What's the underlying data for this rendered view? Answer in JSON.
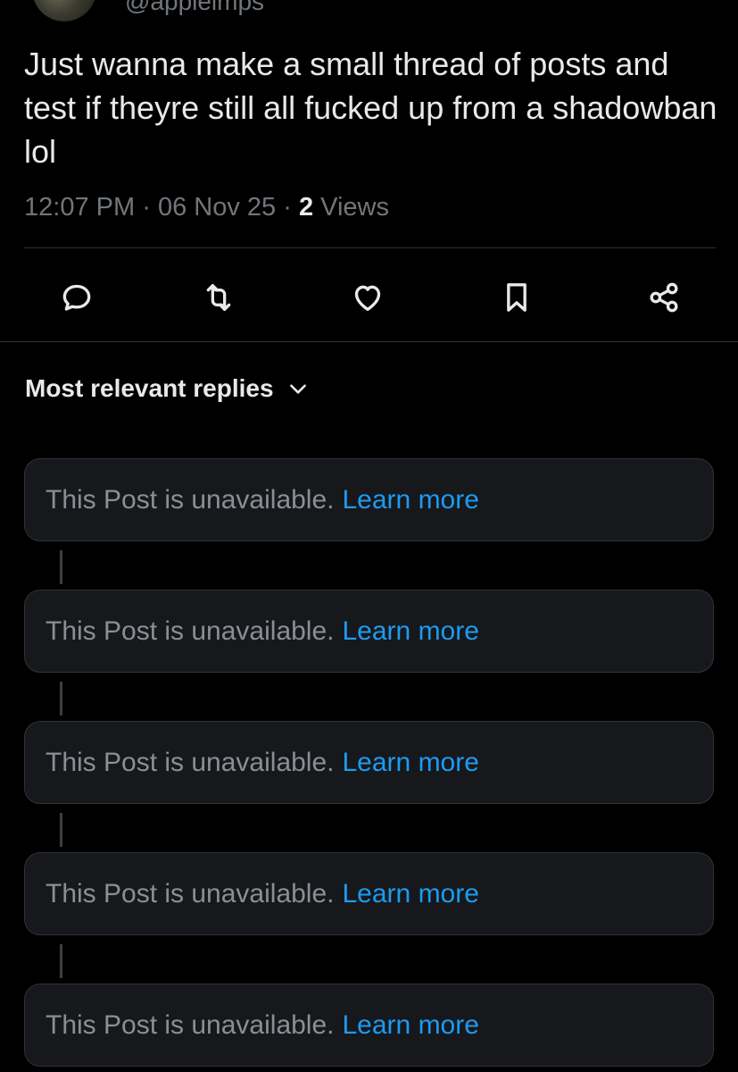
{
  "author": {
    "handle": "@appleimps"
  },
  "post": {
    "text": "Just wanna make a small thread of posts and test if theyre still all fucked up from a shadowban lol",
    "time": "12:07 PM",
    "sep": "·",
    "date": "06 Nov 25",
    "views_count": "2",
    "views_label": "Views"
  },
  "actions": [
    {
      "name": "reply-icon"
    },
    {
      "name": "repost-icon"
    },
    {
      "name": "like-icon"
    },
    {
      "name": "bookmark-icon"
    },
    {
      "name": "share-icon"
    }
  ],
  "replies": {
    "sort_label": "Most relevant replies",
    "items": [
      {
        "message": "This Post is unavailable.",
        "link": "Learn more"
      },
      {
        "message": "This Post is unavailable.",
        "link": "Learn more"
      },
      {
        "message": "This Post is unavailable.",
        "link": "Learn more"
      },
      {
        "message": "This Post is unavailable.",
        "link": "Learn more"
      },
      {
        "message": "This Post is unavailable.",
        "link": "Learn more"
      }
    ]
  },
  "colors": {
    "background": "#000000",
    "text_primary": "#e7e9ea",
    "text_secondary": "#71767b",
    "link": "#1d9bf0",
    "card_bg": "#16181c",
    "divider": "#2f3336"
  }
}
